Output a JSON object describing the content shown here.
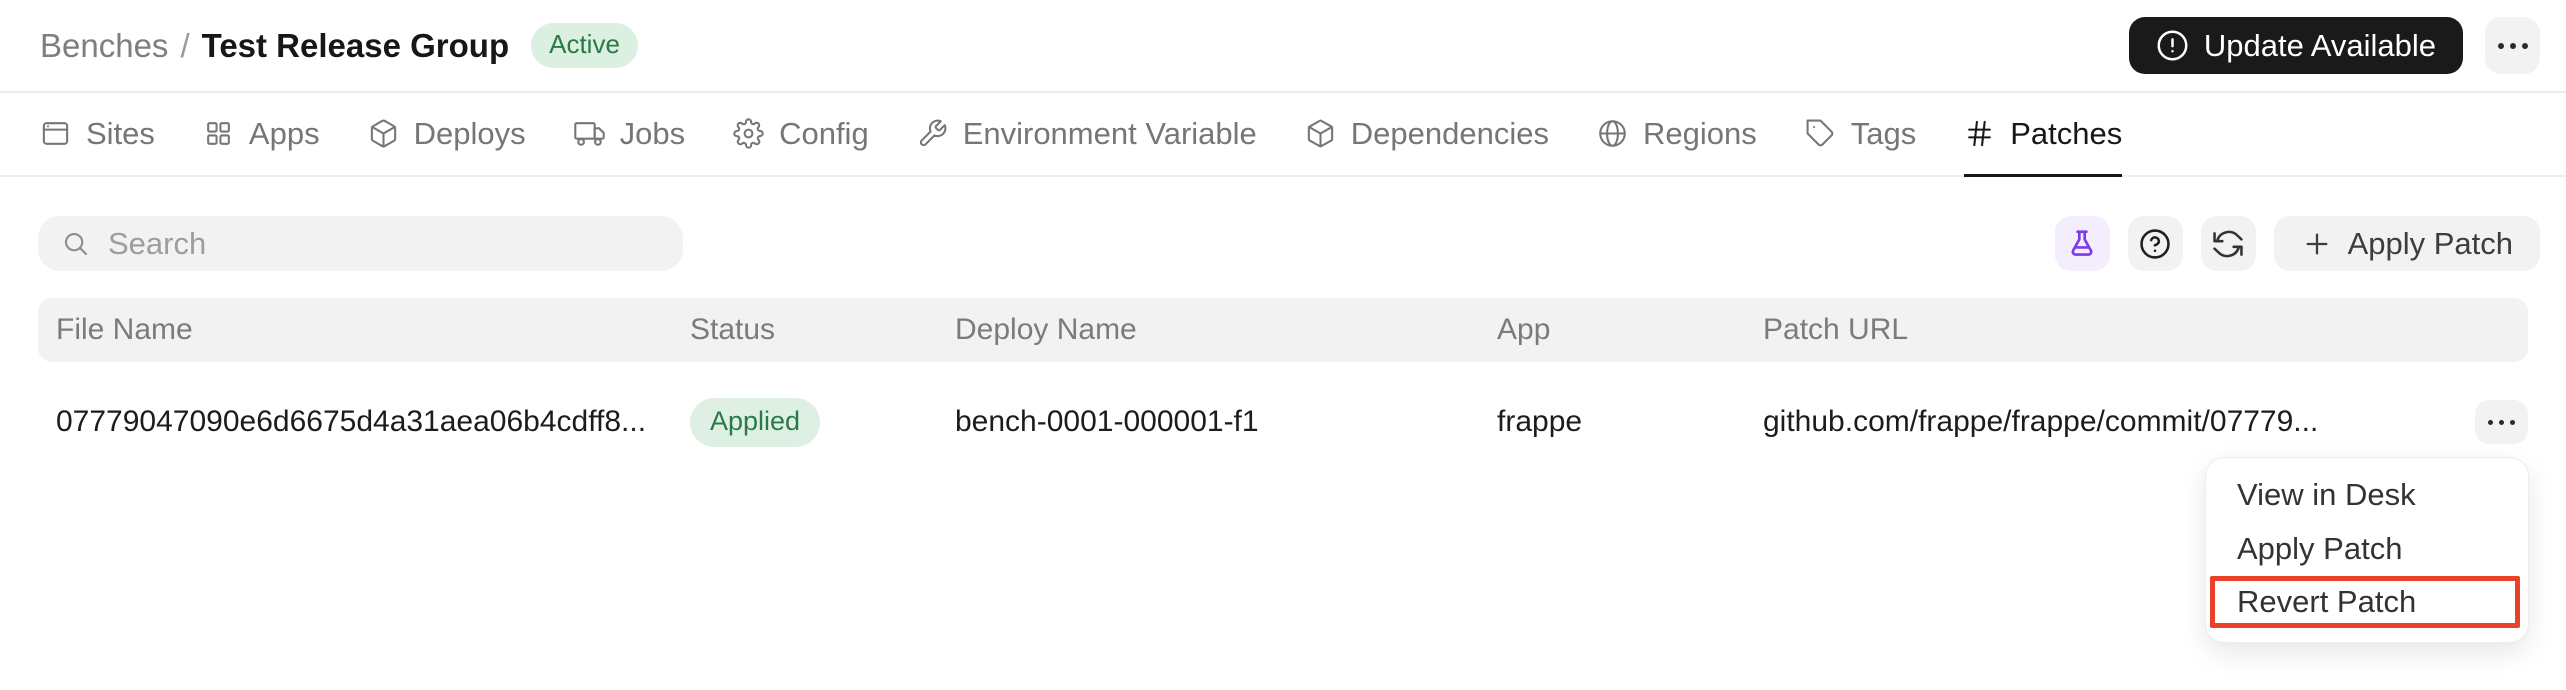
{
  "header": {
    "breadcrumb": {
      "parent": "Benches",
      "separator": "/",
      "current": "Test Release Group"
    },
    "status_badge": "Active",
    "update_button_label": "Update Available"
  },
  "tabs": [
    {
      "label": "Sites",
      "icon": "window-icon",
      "active": false
    },
    {
      "label": "Apps",
      "icon": "grid-icon",
      "active": false
    },
    {
      "label": "Deploys",
      "icon": "package-icon",
      "active": false
    },
    {
      "label": "Jobs",
      "icon": "truck-icon",
      "active": false
    },
    {
      "label": "Config",
      "icon": "gear-icon",
      "active": false
    },
    {
      "label": "Environment Variable",
      "icon": "wrench-icon",
      "active": false
    },
    {
      "label": "Dependencies",
      "icon": "box-icon",
      "active": false
    },
    {
      "label": "Regions",
      "icon": "globe-icon",
      "active": false
    },
    {
      "label": "Tags",
      "icon": "tag-icon",
      "active": false
    },
    {
      "label": "Patches",
      "icon": "hash-icon",
      "active": true
    }
  ],
  "toolbar": {
    "search_placeholder": "Search",
    "search_value": "",
    "apply_patch_label": "Apply Patch"
  },
  "table": {
    "columns": [
      "File Name",
      "Status",
      "Deploy Name",
      "App",
      "Patch URL"
    ],
    "rows": [
      {
        "file_name": "07779047090e6d6675d4a31aea06b4cdff8...",
        "status": "Applied",
        "deploy_name": "bench-0001-000001-f1",
        "app": "frappe",
        "patch_url": "github.com/frappe/frappe/commit/07779..."
      }
    ]
  },
  "context_menu": {
    "items": [
      {
        "label": "View in Desk",
        "highlighted": false
      },
      {
        "label": "Apply Patch",
        "highlighted": false
      },
      {
        "label": "Revert Patch",
        "highlighted": true
      }
    ]
  },
  "colors": {
    "accent_purple": "#7c3aed",
    "badge_green_bg": "#def0e4",
    "badge_green_text": "#2a7a48",
    "highlight_red": "#e8432a",
    "dark_button": "#1a1a1a"
  }
}
